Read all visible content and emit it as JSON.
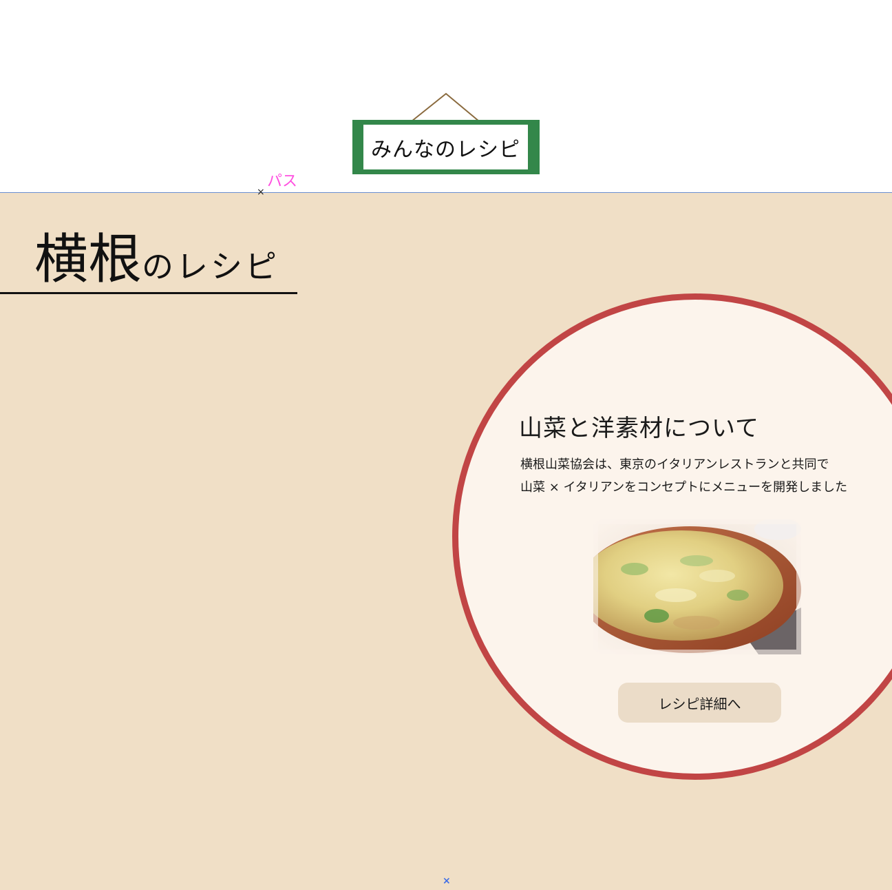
{
  "header": {
    "sign_label": "みんなのレシピ"
  },
  "editor": {
    "path_label": "パス",
    "path_marker": "×",
    "bottom_marker": "×"
  },
  "section": {
    "heading_main": "横根",
    "heading_sub": "のレシピ"
  },
  "feature": {
    "title": "山菜と洋素材について",
    "description_line1": "横根山菜協会は、東京のイタリアンレストランと共同で",
    "description_line2": "山菜 × イタリアンをコンセプトにメニューを開発しました",
    "button_label": "レシピ詳細へ"
  },
  "colors": {
    "sign_frame": "#33874a",
    "background": "#f0dfc6",
    "circle_border": "#c14545",
    "circle_fill": "#fcf4ec",
    "button_fill": "#ebdcc8",
    "path_label": "#ff4fe0",
    "guide_line": "#6a8ed1"
  }
}
